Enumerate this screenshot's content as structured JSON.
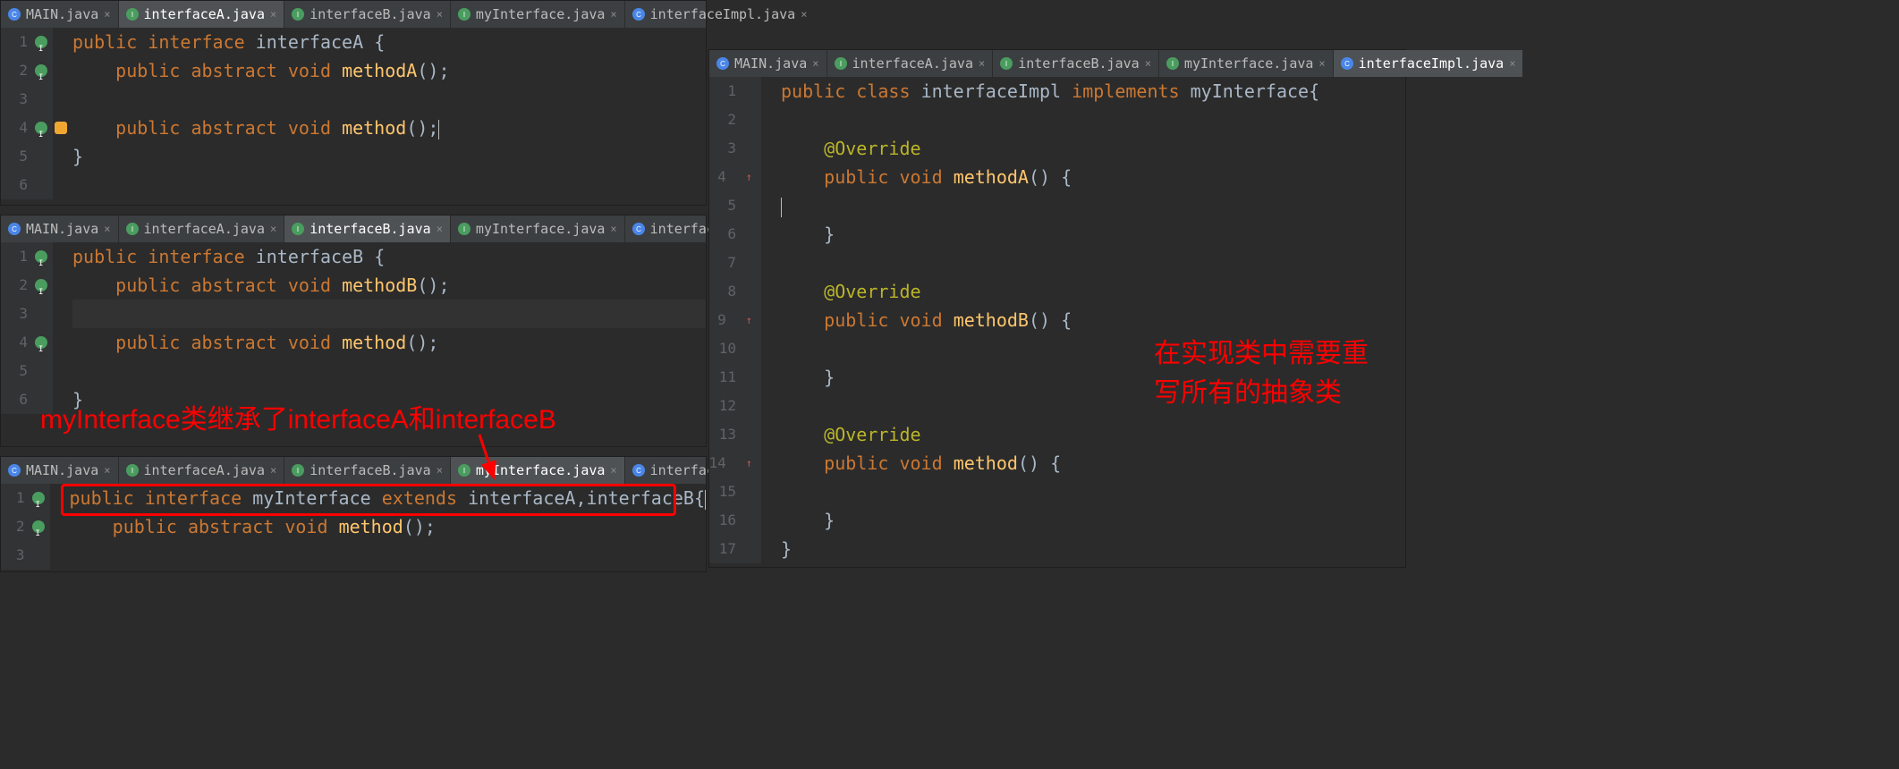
{
  "tabs_common": [
    {
      "label": "MAIN.java",
      "icon": "class"
    },
    {
      "label": "interfaceA.java",
      "icon": "interface"
    },
    {
      "label": "interfaceB.java",
      "icon": "interface"
    },
    {
      "label": "myInterface.java",
      "icon": "interface"
    },
    {
      "label": "interfaceImpl.java",
      "icon": "class"
    }
  ],
  "pane1": {
    "active_tab": 1,
    "lines": [
      {
        "n": "1",
        "tokens": [
          [
            "kw",
            "public"
          ],
          [
            "sp",
            " "
          ],
          [
            "kw",
            "interface"
          ],
          [
            "sp",
            " "
          ],
          [
            "type",
            "interfaceA"
          ],
          [
            "sp",
            " "
          ],
          [
            "brace",
            "{"
          ]
        ]
      },
      {
        "n": "2",
        "tokens": [
          [
            "sp",
            "    "
          ],
          [
            "kw",
            "public"
          ],
          [
            "sp",
            " "
          ],
          [
            "kw",
            "abstract"
          ],
          [
            "sp",
            " "
          ],
          [
            "kw",
            "void"
          ],
          [
            "sp",
            " "
          ],
          [
            "method",
            "methodA"
          ],
          [
            "punct",
            "();"
          ]
        ]
      },
      {
        "n": "3",
        "tokens": []
      },
      {
        "n": "4",
        "bulb": true,
        "tokens": [
          [
            "sp",
            "    "
          ],
          [
            "kw",
            "public"
          ],
          [
            "sp",
            " "
          ],
          [
            "kw",
            "abstract"
          ],
          [
            "sp",
            " "
          ],
          [
            "kw",
            "void"
          ],
          [
            "sp",
            " "
          ],
          [
            "method",
            "method"
          ],
          [
            "punct",
            "();"
          ],
          [
            "cursor",
            ""
          ]
        ]
      },
      {
        "n": "5",
        "tokens": [
          [
            "brace",
            "}"
          ]
        ]
      },
      {
        "n": "6",
        "tokens": []
      }
    ]
  },
  "pane2": {
    "active_tab": 2,
    "lines": [
      {
        "n": "1",
        "tokens": [
          [
            "kw",
            "public"
          ],
          [
            "sp",
            " "
          ],
          [
            "kw",
            "interface"
          ],
          [
            "sp",
            " "
          ],
          [
            "type",
            "interfaceB"
          ],
          [
            "sp",
            " "
          ],
          [
            "brace",
            "{"
          ]
        ]
      },
      {
        "n": "2",
        "tokens": [
          [
            "sp",
            "    "
          ],
          [
            "kw",
            "public"
          ],
          [
            "sp",
            " "
          ],
          [
            "kw",
            "abstract"
          ],
          [
            "sp",
            " "
          ],
          [
            "kw",
            "void"
          ],
          [
            "sp",
            " "
          ],
          [
            "method",
            "methodB"
          ],
          [
            "punct",
            "();"
          ]
        ]
      },
      {
        "n": "3",
        "tokens": [],
        "hl": true
      },
      {
        "n": "4",
        "tokens": [
          [
            "sp",
            "    "
          ],
          [
            "kw",
            "public"
          ],
          [
            "sp",
            " "
          ],
          [
            "kw",
            "abstract"
          ],
          [
            "sp",
            " "
          ],
          [
            "kw",
            "void"
          ],
          [
            "sp",
            " "
          ],
          [
            "method",
            "method"
          ],
          [
            "punct",
            "();"
          ]
        ]
      },
      {
        "n": "5",
        "tokens": []
      },
      {
        "n": "6",
        "tokens": [
          [
            "brace",
            "}"
          ]
        ]
      }
    ]
  },
  "pane3": {
    "active_tab": 3,
    "lines": [
      {
        "n": "1",
        "tokens": [
          [
            "kw",
            "public"
          ],
          [
            "sp",
            " "
          ],
          [
            "kw",
            "interface"
          ],
          [
            "sp",
            " "
          ],
          [
            "type",
            "myInterface"
          ],
          [
            "sp",
            " "
          ],
          [
            "kw",
            "extends"
          ],
          [
            "sp",
            " "
          ],
          [
            "type",
            "interfaceA"
          ],
          [
            "punct",
            ","
          ],
          [
            "type",
            "interfaceB"
          ],
          [
            "brace",
            "{"
          ],
          [
            "cursor",
            ""
          ]
        ]
      },
      {
        "n": "2",
        "tokens": [
          [
            "sp",
            "    "
          ],
          [
            "kw",
            "public"
          ],
          [
            "sp",
            " "
          ],
          [
            "kw",
            "abstract"
          ],
          [
            "sp",
            " "
          ],
          [
            "kw",
            "void"
          ],
          [
            "sp",
            " "
          ],
          [
            "method",
            "method"
          ],
          [
            "punct",
            "();"
          ]
        ]
      },
      {
        "n": "3",
        "tokens": []
      }
    ]
  },
  "pane4": {
    "active_tab": 4,
    "lines": [
      {
        "n": "1",
        "tokens": [
          [
            "kw",
            "public"
          ],
          [
            "sp",
            " "
          ],
          [
            "kw",
            "class"
          ],
          [
            "sp",
            " "
          ],
          [
            "type",
            "interfaceImpl"
          ],
          [
            "sp",
            " "
          ],
          [
            "kw",
            "implements"
          ],
          [
            "sp",
            " "
          ],
          [
            "type",
            "myInterface"
          ],
          [
            "brace",
            "{"
          ]
        ]
      },
      {
        "n": "2",
        "tokens": []
      },
      {
        "n": "3",
        "tokens": [
          [
            "sp",
            "    "
          ],
          [
            "annot",
            "@Override"
          ]
        ]
      },
      {
        "n": "4",
        "up": true,
        "tokens": [
          [
            "sp",
            "    "
          ],
          [
            "kw",
            "public"
          ],
          [
            "sp",
            " "
          ],
          [
            "kw",
            "void"
          ],
          [
            "sp",
            " "
          ],
          [
            "method",
            "methodA"
          ],
          [
            "punct",
            "()"
          ],
          [
            "sp",
            " "
          ],
          [
            "brace",
            "{"
          ]
        ]
      },
      {
        "n": "5",
        "tokens": [
          [
            "cursor",
            ""
          ]
        ]
      },
      {
        "n": "6",
        "tokens": [
          [
            "sp",
            "    "
          ],
          [
            "brace",
            "}"
          ]
        ]
      },
      {
        "n": "7",
        "tokens": []
      },
      {
        "n": "8",
        "tokens": [
          [
            "sp",
            "    "
          ],
          [
            "annot",
            "@Override"
          ]
        ]
      },
      {
        "n": "9",
        "up": true,
        "tokens": [
          [
            "sp",
            "    "
          ],
          [
            "kw",
            "public"
          ],
          [
            "sp",
            " "
          ],
          [
            "kw",
            "void"
          ],
          [
            "sp",
            " "
          ],
          [
            "method",
            "methodB"
          ],
          [
            "punct",
            "()"
          ],
          [
            "sp",
            " "
          ],
          [
            "brace",
            "{"
          ]
        ]
      },
      {
        "n": "10",
        "tokens": []
      },
      {
        "n": "11",
        "tokens": [
          [
            "sp",
            "    "
          ],
          [
            "brace",
            "}"
          ]
        ]
      },
      {
        "n": "12",
        "tokens": []
      },
      {
        "n": "13",
        "tokens": [
          [
            "sp",
            "    "
          ],
          [
            "annot",
            "@Override"
          ]
        ]
      },
      {
        "n": "14",
        "up": true,
        "tokens": [
          [
            "sp",
            "    "
          ],
          [
            "kw",
            "public"
          ],
          [
            "sp",
            " "
          ],
          [
            "kw",
            "void"
          ],
          [
            "sp",
            " "
          ],
          [
            "method",
            "method"
          ],
          [
            "punct",
            "()"
          ],
          [
            "sp",
            " "
          ],
          [
            "brace",
            "{"
          ]
        ]
      },
      {
        "n": "15",
        "tokens": []
      },
      {
        "n": "16",
        "tokens": [
          [
            "sp",
            "    "
          ],
          [
            "brace",
            "}"
          ]
        ]
      },
      {
        "n": "17",
        "tokens": [
          [
            "brace",
            "}"
          ]
        ]
      }
    ]
  },
  "annotation1": "myInterface类继承了interfaceA和interfaceB",
  "annotation2_line1": "在实现类中需要重",
  "annotation2_line2": "写所有的抽象类"
}
